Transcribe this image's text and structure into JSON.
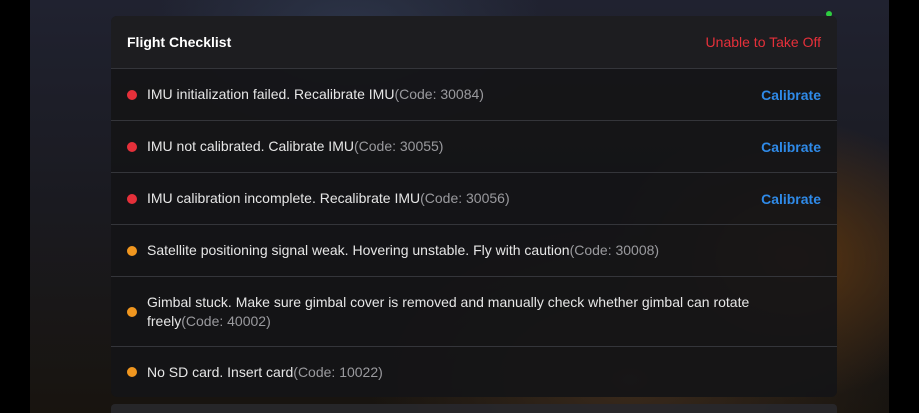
{
  "checklist": {
    "title": "Flight Checklist",
    "status": "Unable to Take Off",
    "status_color": "#e5303a",
    "items": [
      {
        "severity": "error",
        "message": "IMU initialization failed. Recalibrate IMU",
        "code": "(Code: 30084)",
        "action": "Calibrate"
      },
      {
        "severity": "error",
        "message": "IMU not calibrated. Calibrate IMU",
        "code": "(Code: 30055)",
        "action": "Calibrate"
      },
      {
        "severity": "error",
        "message": "IMU calibration incomplete. Recalibrate IMU",
        "code": "(Code: 30056)",
        "action": "Calibrate"
      },
      {
        "severity": "warning",
        "message": "Satellite positioning signal weak. Hovering unstable. Fly with caution",
        "code": "(Code: 30008)"
      },
      {
        "severity": "warning",
        "message": "Gimbal stuck. Make sure gimbal cover is removed and manually check whether gimbal can rotate freely",
        "code": "(Code: 40002)"
      },
      {
        "severity": "warning",
        "message": "No SD card. Insert card",
        "code": "(Code: 10022)"
      }
    ]
  },
  "colors": {
    "error": "#e5303a",
    "warning": "#f0961f",
    "action": "#2f8ae8",
    "connection": "#2ecc40"
  }
}
